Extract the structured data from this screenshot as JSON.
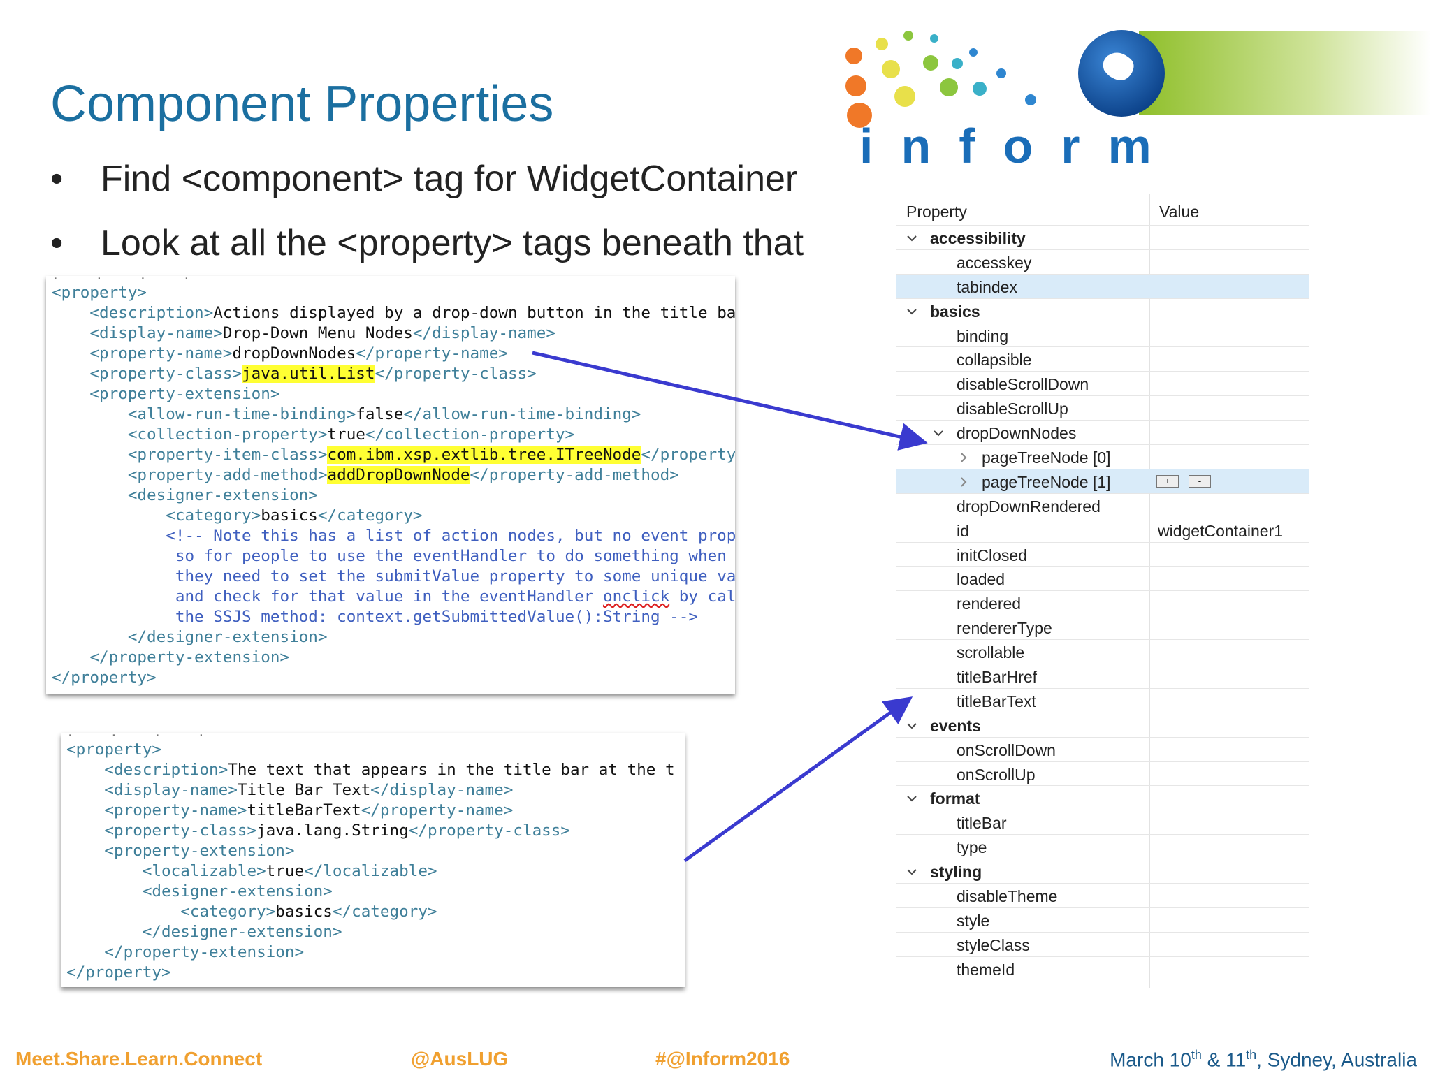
{
  "slide": {
    "title": "Component Properties",
    "bullets": [
      {
        "symbol": "•",
        "text": "Find <component> tag for WidgetContainer"
      },
      {
        "symbol": "•",
        "text": "Look at all the <property> tags beneath that"
      }
    ]
  },
  "logo": {
    "text": "inform"
  },
  "code_top": {
    "lines": [
      [
        {
          "t": "<property>",
          "c": "tag"
        }
      ],
      [
        {
          "t": "    "
        },
        {
          "t": "<description>",
          "c": "tag"
        },
        {
          "t": "Actions displayed by a drop-down button in the title ba"
        }
      ],
      [
        {
          "t": "    "
        },
        {
          "t": "<display-name>",
          "c": "tag"
        },
        {
          "t": "Drop-Down Menu Nodes"
        },
        {
          "t": "</display-name>",
          "c": "tag"
        }
      ],
      [
        {
          "t": "    "
        },
        {
          "t": "<property-name>",
          "c": "tag"
        },
        {
          "t": "dropDownNodes"
        },
        {
          "t": "</property-name>",
          "c": "tag"
        }
      ],
      [
        {
          "t": "    "
        },
        {
          "t": "<property-class>",
          "c": "tag"
        },
        {
          "t": "java.util.List",
          "c": "hl"
        },
        {
          "t": "</property-class>",
          "c": "tag"
        }
      ],
      [
        {
          "t": "    "
        },
        {
          "t": "<property-extension>",
          "c": "tag"
        }
      ],
      [
        {
          "t": "        "
        },
        {
          "t": "<allow-run-time-binding>",
          "c": "tag"
        },
        {
          "t": "false"
        },
        {
          "t": "</allow-run-time-binding>",
          "c": "tag"
        }
      ],
      [
        {
          "t": "        "
        },
        {
          "t": "<collection-property>",
          "c": "tag"
        },
        {
          "t": "true"
        },
        {
          "t": "</collection-property>",
          "c": "tag"
        }
      ],
      [
        {
          "t": "        "
        },
        {
          "t": "<property-item-class>",
          "c": "tag"
        },
        {
          "t": "com.ibm.xsp.extlib.tree.ITreeNode",
          "c": "hl"
        },
        {
          "t": "</property",
          "c": "tag"
        }
      ],
      [
        {
          "t": "        "
        },
        {
          "t": "<property-add-method>",
          "c": "tag"
        },
        {
          "t": "addDropDownNode",
          "c": "hl"
        },
        {
          "t": "</property-add-method>",
          "c": "tag"
        }
      ],
      [
        {
          "t": "        "
        },
        {
          "t": "<designer-extension>",
          "c": "tag"
        }
      ],
      [
        {
          "t": "            "
        },
        {
          "t": "<category>",
          "c": "tag"
        },
        {
          "t": "basics"
        },
        {
          "t": "</category>",
          "c": "tag"
        }
      ],
      [
        {
          "t": "            "
        },
        {
          "t": "<!-- Note this has a list of action nodes, but no event prop",
          "c": "cm"
        }
      ],
      [
        {
          "t": "             "
        },
        {
          "t": "so for people to use the eventHandler to do something when ",
          "c": "cm"
        }
      ],
      [
        {
          "t": "             "
        },
        {
          "t": "they need to set the submitValue property to some unique va",
          "c": "cm"
        }
      ],
      [
        {
          "t": "             "
        },
        {
          "t": "and check for that value in the eventHandler ",
          "c": "cm"
        },
        {
          "t": "onclick",
          "c": "cm sq"
        },
        {
          "t": " by cal",
          "c": "cm"
        }
      ],
      [
        {
          "t": "             "
        },
        {
          "t": "the SSJS method: context.getSubmittedValue():String -->",
          "c": "cm"
        }
      ],
      [
        {
          "t": "        "
        },
        {
          "t": "</designer-extension>",
          "c": "tag"
        }
      ],
      [
        {
          "t": "    "
        },
        {
          "t": "</property-extension>",
          "c": "tag"
        }
      ],
      [
        {
          "t": "</property>",
          "c": "tag"
        }
      ]
    ]
  },
  "code_bottom": {
    "lines": [
      [
        {
          "t": "<property>",
          "c": "tag"
        }
      ],
      [
        {
          "t": "    "
        },
        {
          "t": "<description>",
          "c": "tag"
        },
        {
          "t": "The text that appears in the title bar at the t"
        }
      ],
      [
        {
          "t": "    "
        },
        {
          "t": "<display-name>",
          "c": "tag"
        },
        {
          "t": "Title Bar Text"
        },
        {
          "t": "</display-name>",
          "c": "tag"
        }
      ],
      [
        {
          "t": "    "
        },
        {
          "t": "<property-name>",
          "c": "tag"
        },
        {
          "t": "titleBarText"
        },
        {
          "t": "</property-name>",
          "c": "tag"
        }
      ],
      [
        {
          "t": "    "
        },
        {
          "t": "<property-class>",
          "c": "tag"
        },
        {
          "t": "java.lang.String"
        },
        {
          "t": "</property-class>",
          "c": "tag"
        }
      ],
      [
        {
          "t": "    "
        },
        {
          "t": "<property-extension>",
          "c": "tag"
        }
      ],
      [
        {
          "t": "        "
        },
        {
          "t": "<localizable>",
          "c": "tag"
        },
        {
          "t": "true"
        },
        {
          "t": "</localizable>",
          "c": "tag"
        }
      ],
      [
        {
          "t": "        "
        },
        {
          "t": "<designer-extension>",
          "c": "tag"
        }
      ],
      [
        {
          "t": "            "
        },
        {
          "t": "<category>",
          "c": "tag"
        },
        {
          "t": "basics"
        },
        {
          "t": "</category>",
          "c": "tag"
        }
      ],
      [
        {
          "t": "        "
        },
        {
          "t": "</designer-extension>",
          "c": "tag"
        }
      ],
      [
        {
          "t": "    "
        },
        {
          "t": "</property-extension>",
          "c": "tag"
        }
      ],
      [
        {
          "t": "</property>",
          "c": "tag"
        }
      ]
    ]
  },
  "properties_panel": {
    "header_property": "Property",
    "header_value": "Value",
    "add_label": "+",
    "remove_label": "-",
    "rows": [
      {
        "name": "accessibility",
        "level": 0,
        "category": true,
        "expand": "open"
      },
      {
        "name": "accesskey",
        "level": 1
      },
      {
        "name": "tabindex",
        "level": 1,
        "selected": true
      },
      {
        "name": "basics",
        "level": 0,
        "category": true,
        "expand": "open"
      },
      {
        "name": "binding",
        "level": 1
      },
      {
        "name": "collapsible",
        "level": 1
      },
      {
        "name": "disableScrollDown",
        "level": 1
      },
      {
        "name": "disableScrollUp",
        "level": 1
      },
      {
        "name": "dropDownNodes",
        "level": 1,
        "expand": "open"
      },
      {
        "name": "pageTreeNode [0]",
        "level": 2,
        "expand": "closed"
      },
      {
        "name": "pageTreeNode [1]",
        "level": 2,
        "expand": "closed",
        "selected": true,
        "buttons": true
      },
      {
        "name": "dropDownRendered",
        "level": 1
      },
      {
        "name": "id",
        "level": 1,
        "value": "widgetContainer1"
      },
      {
        "name": "initClosed",
        "level": 1
      },
      {
        "name": "loaded",
        "level": 1
      },
      {
        "name": "rendered",
        "level": 1
      },
      {
        "name": "rendererType",
        "level": 1
      },
      {
        "name": "scrollable",
        "level": 1
      },
      {
        "name": "titleBarHref",
        "level": 1
      },
      {
        "name": "titleBarText",
        "level": 1
      },
      {
        "name": "events",
        "level": 0,
        "category": true,
        "expand": "open"
      },
      {
        "name": "onScrollDown",
        "level": 1
      },
      {
        "name": "onScrollUp",
        "level": 1
      },
      {
        "name": "format",
        "level": 0,
        "category": true,
        "expand": "open"
      },
      {
        "name": "titleBar",
        "level": 1
      },
      {
        "name": "type",
        "level": 1
      },
      {
        "name": "styling",
        "level": 0,
        "category": true,
        "expand": "open"
      },
      {
        "name": "disableTheme",
        "level": 1
      },
      {
        "name": "style",
        "level": 1
      },
      {
        "name": "styleClass",
        "level": 1
      },
      {
        "name": "themeId",
        "level": 1
      }
    ]
  },
  "footer": {
    "tagline": "Meet.Share.Learn.Connect",
    "twitter": "@AusLUG",
    "hashtag": "#@Inform2016",
    "date_parts": [
      {
        "t": "March 10"
      },
      {
        "t": "th",
        "sup": true
      },
      {
        "t": " & 11"
      },
      {
        "t": "th",
        "sup": true
      },
      {
        "t": ", Sydney, Australia"
      }
    ]
  },
  "colors": {
    "title": "#1b6fa0",
    "arrow": "#3a3acf",
    "highlight": "#ffff33",
    "xml_tag": "#3f7f99",
    "xml_comment": "#3f5fbf",
    "footer_orange": "#f0a030",
    "footer_blue": "#1b5a8a",
    "selected_row": "#d9ebf9"
  }
}
